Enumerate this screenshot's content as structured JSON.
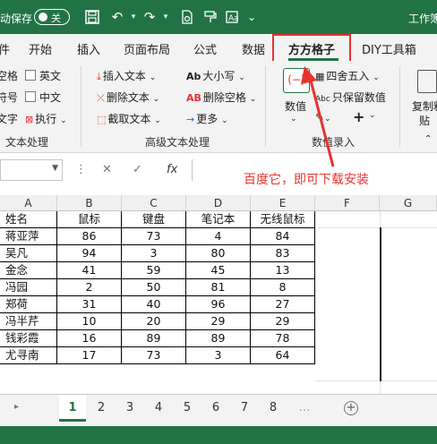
{
  "titlebar": {
    "autosave": "动保存",
    "toggle_state": "关",
    "doc_title": "工作簿"
  },
  "tabs": [
    "件",
    "开始",
    "插入",
    "页面布局",
    "公式",
    "数据",
    "方方格子",
    "DIY工具箱"
  ],
  "ribbon": {
    "left_col1": [
      "空格",
      "符号",
      "文字"
    ],
    "left_col2": [
      "英文",
      "中文",
      "执行"
    ],
    "insert_text": "插入文本",
    "delete_text": "删除文本",
    "cut_text": "截取文本",
    "case": "大小写",
    "delete_space": "删除空格",
    "more": "更多",
    "numeric_label": "数值",
    "round": "四舍五入",
    "keep_numeric": "只保留数值",
    "copy_paste": [
      "复制粘",
      "贴"
    ],
    "groups": {
      "text_processing": "文本处理",
      "advanced_text": "高级文本处理",
      "numeric_entry": "数值录入"
    }
  },
  "formula_bar": {
    "cancel": "✕",
    "enter": "✓",
    "fx": "fx"
  },
  "annotation": "百度它，即可下载安装",
  "columns": [
    "A",
    "B",
    "C",
    "D",
    "E",
    "F",
    "G"
  ],
  "table": {
    "headers": [
      "姓名",
      "鼠标",
      "键盘",
      "笔记本",
      "无线鼠标"
    ],
    "rows": [
      [
        "蒋亚萍",
        "86",
        "73",
        "4",
        "84"
      ],
      [
        "吴凡",
        "94",
        "3",
        "80",
        "83"
      ],
      [
        "金念",
        "41",
        "59",
        "45",
        "13"
      ],
      [
        "冯园",
        "2",
        "50",
        "81",
        "8"
      ],
      [
        "郑荷",
        "31",
        "40",
        "96",
        "27"
      ],
      [
        "冯半芹",
        "10",
        "20",
        "29",
        "29"
      ],
      [
        "钱彩霞",
        "16",
        "89",
        "89",
        "78"
      ],
      [
        "尤寻南",
        "17",
        "73",
        "3",
        "64"
      ]
    ]
  },
  "sheets": [
    "1",
    "2",
    "3",
    "4",
    "5",
    "6",
    "7",
    "8"
  ],
  "colors": {
    "excel_green": "#217346",
    "annotation_red": "#e8332f"
  }
}
